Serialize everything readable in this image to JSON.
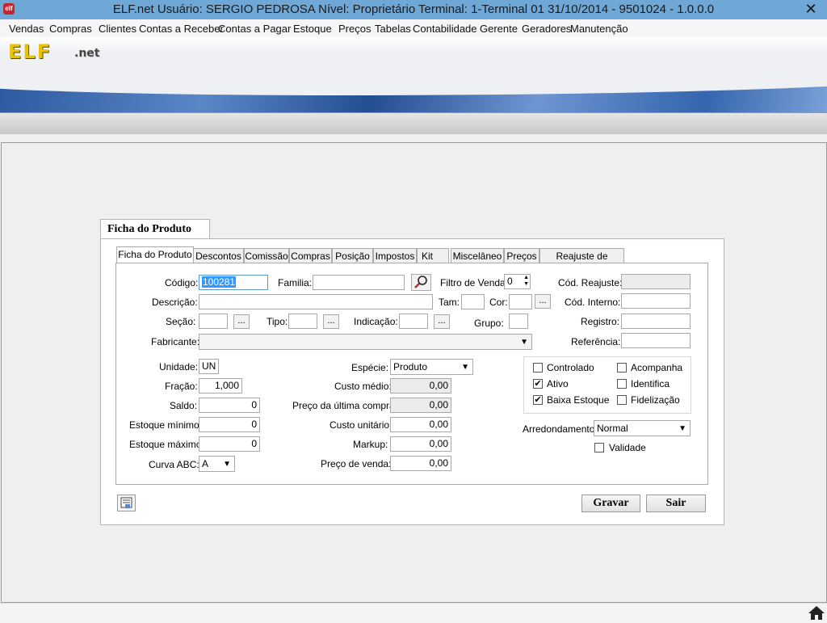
{
  "window": {
    "title": "ELF.net    Usuário: SERGIO PEDROSA    Nível: Proprietário    Terminal: 1-Terminal 01    31/10/2014 - 9501024 - 1.0.0.0",
    "icon_text": "elf",
    "close_glyph": "✕"
  },
  "menu": [
    "Vendas",
    "Compras",
    "Clientes",
    "Contas a Receber",
    "Contas a Pagar",
    "Estoque",
    "Preços",
    "Tabelas",
    "Contabilidade",
    "Gerente",
    "Geradores",
    "Manutenção"
  ],
  "banner": {
    "logo": "ELF",
    "logo_suffix": ".net"
  },
  "form": {
    "title": "Ficha do Produto",
    "tabs": [
      "Ficha do Produto",
      "Descontos",
      "Comissão",
      "Compras",
      "Posição",
      "Impostos",
      "Kit",
      "Miscelâneo",
      "Preços",
      "Reajuste de Preços"
    ],
    "active_tab": 0,
    "labels": {
      "codigo": "Código:",
      "familia": "Familia:",
      "filtro_venda": "Filtro de Venda:",
      "cod_reajuste": "Cód. Reajuste:",
      "descricao": "Descrição:",
      "tam": "Tam:",
      "cor": "Cor:",
      "cod_interno": "Cód. Interno:",
      "secao": "Seção:",
      "tipo": "Tipo:",
      "indicacao": "Indicação:",
      "grupo": "Grupo:",
      "registro": "Registro:",
      "fabricante": "Fabricante:",
      "referencia": "Referência:",
      "unidade": "Unidade:",
      "fracao": "Fração:",
      "saldo": "Saldo:",
      "estoque_minimo": "Estoque mínimo:",
      "estoque_maximo": "Estoque máximo:",
      "curva_abc": "Curva ABC:",
      "especie": "Espécie:",
      "custo_medio": "Custo médio:",
      "preco_ultima_compra": "Preço da última compra:",
      "custo_unitario": "Custo unitário:",
      "markup": "Markup:",
      "preco_venda": "Preço de venda:",
      "arredondamento": "Arredondamento:"
    },
    "values": {
      "codigo": "100281",
      "filtro_venda": "0",
      "unidade": "UN",
      "fracao": "1,000",
      "saldo": "0",
      "estoque_minimo": "0",
      "estoque_maximo": "0",
      "curva_abc": "A",
      "especie": "Produto",
      "custo_medio": "0,00",
      "preco_ultima_compra": "0,00",
      "custo_unitario": "0,00",
      "markup": "0,00",
      "preco_venda": "0,00",
      "arredondamento": "Normal"
    },
    "checkboxes": [
      {
        "label": "Controlado",
        "checked": false
      },
      {
        "label": "Acompanha",
        "checked": false
      },
      {
        "label": "Ativo",
        "checked": true
      },
      {
        "label": "Identifica",
        "checked": false
      },
      {
        "label": "Baixa Estoque",
        "checked": true
      },
      {
        "label": "Fidelização",
        "checked": false
      }
    ],
    "validade": {
      "label": "Validade",
      "checked": false
    },
    "ellipsis": "...",
    "buttons": {
      "gravar": "Gravar",
      "sair": "Sair"
    }
  }
}
